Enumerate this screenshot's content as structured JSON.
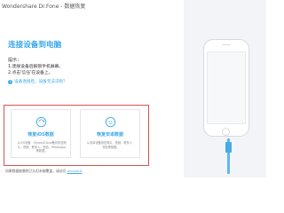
{
  "window": {
    "title": "Wondershare Dr.Fone - 数据恢复",
    "controls": [
      "menu-icon",
      "minimize-icon",
      "close-icon"
    ]
  },
  "main": {
    "heading": "连接设备到电脑",
    "tips_title": "提示：",
    "tips": [
      "1.连接设备后解锁手机屏幕。",
      "2.点击'信任'在设备上。"
    ],
    "help_link": "设备连接后，设备无法识别？"
  },
  "options": [
    {
      "title": "恢复iOS数据",
      "description": "从iOS设备、iTunes/iCloud备份恢复照片、视频、联系人、短信、WhatsApp等数据。",
      "icon": "recover-ios-icon"
    },
    {
      "title": "恢复安卓数据",
      "description": "从安卓设备恢复照片、视频、联系人、短信等数据。",
      "icon": "recover-android-icon"
    }
  ],
  "footer": {
    "note": "如果数据被删除已久但未被覆盖，请访问",
    "link": "recoverit"
  },
  "colors": {
    "accent": "#3ba7e8",
    "highlight_border": "#d9534f",
    "panel_bg": "#f2f4f7"
  }
}
